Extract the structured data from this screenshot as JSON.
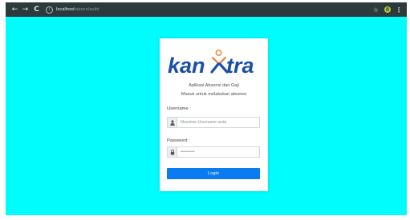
{
  "browser": {
    "back_glyph": "←",
    "forward_glyph": "→",
    "reload_glyph": "C",
    "info_glyph": "i",
    "url_host": "localhost",
    "url_path": "/absen/auth/",
    "star_glyph": "☆",
    "menu_glyph": "⋮",
    "icons": [
      "back-arrow-icon",
      "forward-arrow-icon",
      "reload-icon",
      "site-info-icon",
      "bookmark-star-icon",
      "extension-icon",
      "kebab-menu-icon"
    ]
  },
  "page": {
    "background_color": "#00fdfd"
  },
  "login": {
    "logo_text": "kan  tra",
    "logo_color": "#1a4fa8",
    "logo_accent_color": "#f07c2a",
    "subtitle_line1": "Aplikasi Absensi dan Gaji",
    "subtitle_line2": "Masuk untuk melakukan absensi",
    "username_label": "Username :",
    "username_placeholder": "Masukan Username anda",
    "password_label": "Password :",
    "password_value": "••••••••••",
    "user_icon": "user-icon",
    "lock_icon": "lock-icon",
    "login_button": "Login",
    "button_color": "#0a7bf0"
  }
}
